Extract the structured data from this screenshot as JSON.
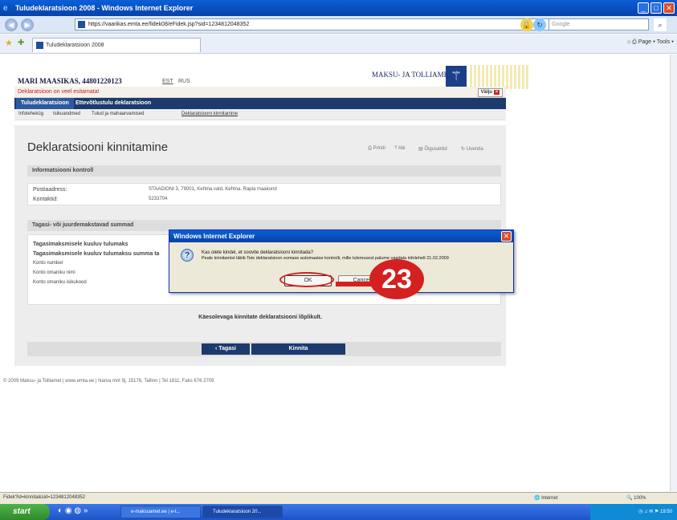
{
  "window": {
    "title": "Tuludeklaratsioon 2008 - Windows Internet Explorer"
  },
  "browser": {
    "url": "https://vaarikas.emta.ee/fidek08/eFidek.jsp?sid=1234812048352",
    "search_placeholder": "Google",
    "tab_title": "Tuludeklaratsioon 2008",
    "tools": "Page ▾  Tools ▾"
  },
  "page": {
    "user": "MARI MAASIKAS, 44801220123",
    "lang_est": "EST",
    "lang_rus": "RUS",
    "logo_text": "MAKSU- JA TOLLIAMET",
    "warning": "Deklaratsioon on veel esitamata!",
    "exit_label": "Välju",
    "nav_tabs": [
      "Tuludeklaratsioon",
      "Ettevõtlustulu deklaratsioon"
    ],
    "sub_nav": [
      "Infoleheküg",
      "Isikuandmed",
      "Tulud ja mahaarvamised",
      "Deklaratsiooni kinnitamine"
    ],
    "title": "Deklaratsiooni kinnitamine",
    "toolbar": [
      "Prindi",
      "Abi",
      "Õigusaktid",
      "Uuenda"
    ],
    "info_section": "Informatsiooni kontroll",
    "address_label": "Postiaadress:",
    "address_value": "STAADIONI 3, 79001, Kehtna vald, Kehtna, Rapla maakond",
    "contact_label": "Kontaktid:",
    "contact_value": "5233704",
    "refund_section": "Tagasi- või juurdemakstavad summad",
    "refund_rows": [
      "Tagasimaksmisele kuuluv tulumaks",
      "Tagasimaksmisele kuuluv tulumaksu summa ta",
      "Konto number",
      "Konto omaniku nimi",
      "Konto omaniku isikukood"
    ],
    "confirm_text": "Käesolevaga kinnitate deklaratsiooni lõplikult.",
    "back_button": "‹ Tagasi",
    "confirm_button": "Kinnita",
    "footer": "© 2009 Maksu- ja Tolliamet  |  www.emta.ee  |  Narva mnt 9j, 15176, Tallinn  |  Tel 1811, Faks 676 2709"
  },
  "dialog": {
    "title": "Windows Internet Explorer",
    "question": "Kas olete kindel, et soovite deklaratsiooni kinnitada?",
    "detail": "Peale kinnitamist läbib Teie deklaratsioon esmase automaatse kontrolli, mille tulemusest palume vaadata infolehelt 21.02.2009",
    "ok": "OK",
    "cancel": "Cancel"
  },
  "annotation": {
    "step": "23"
  },
  "statusbar": {
    "text": "Fidek?id=kinnita&sid=1234812048352",
    "zone": "Internet",
    "zoom": "100%"
  },
  "taskbar": {
    "start": "start",
    "tasks": [
      "e-maksuamet.ee | e-t...",
      "Tuludeklaratsioon 20..."
    ],
    "clock": "19:50"
  }
}
